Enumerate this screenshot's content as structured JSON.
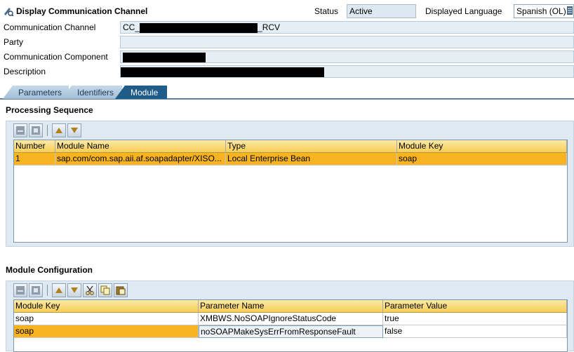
{
  "header": {
    "title": "Display Communication Channel",
    "status_label": "Status",
    "status_value": "Active",
    "language_label": "Displayed Language",
    "language_value": "Spanish (OL)"
  },
  "fields": {
    "channel_label": "Communication Channel",
    "channel_prefix": "CC_",
    "channel_suffix": "_RCV",
    "party_label": "Party",
    "component_label": "Communication Component",
    "description_label": "Description"
  },
  "tabs": [
    {
      "label": "Parameters"
    },
    {
      "label": "Identifiers"
    },
    {
      "label": "Module"
    }
  ],
  "processing": {
    "title": "Processing Sequence",
    "columns": [
      "Number",
      "Module Name",
      "Type",
      "Module Key"
    ],
    "rows": [
      [
        "1",
        "sap.com/com.sap.aii.af.soapadapter/XISO...",
        "Local Enterprise Bean",
        "soap"
      ]
    ]
  },
  "config": {
    "title": "Module Configuration",
    "columns": [
      "Module Key",
      "Parameter Name",
      "Parameter Value"
    ],
    "rows": [
      [
        "soap",
        "XMBWS.NoSOAPIgnoreStatusCode",
        "true"
      ],
      [
        "soap",
        "noSOAPMakeSysErrFromResponseFault",
        "false"
      ]
    ]
  },
  "colors": {
    "accent": "#1f5c8a",
    "selection": "#f7b320",
    "panel": "#dfe9f2",
    "header_gradient": "#f7cf55"
  }
}
